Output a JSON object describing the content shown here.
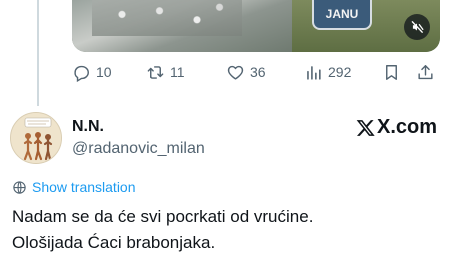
{
  "media": {
    "sign_text": "JANU",
    "mute_icon": "volume-muted-icon"
  },
  "actions": {
    "replies": "10",
    "retweets": "11",
    "likes": "36",
    "views": "292"
  },
  "reply": {
    "display_name": "N.N.",
    "handle": "@radanovic_milan",
    "source_brand": "X.com",
    "show_translation": "Show translation",
    "text_line1": "Nadam se da će svi pocrkati od vrućine.",
    "text_line2": "Ološijada Ćaci brabonjaka."
  },
  "colors": {
    "text_primary": "#0f1419",
    "text_secondary": "#536471",
    "link_blue": "#1d9bf0",
    "thread_line": "#cfd9de"
  }
}
